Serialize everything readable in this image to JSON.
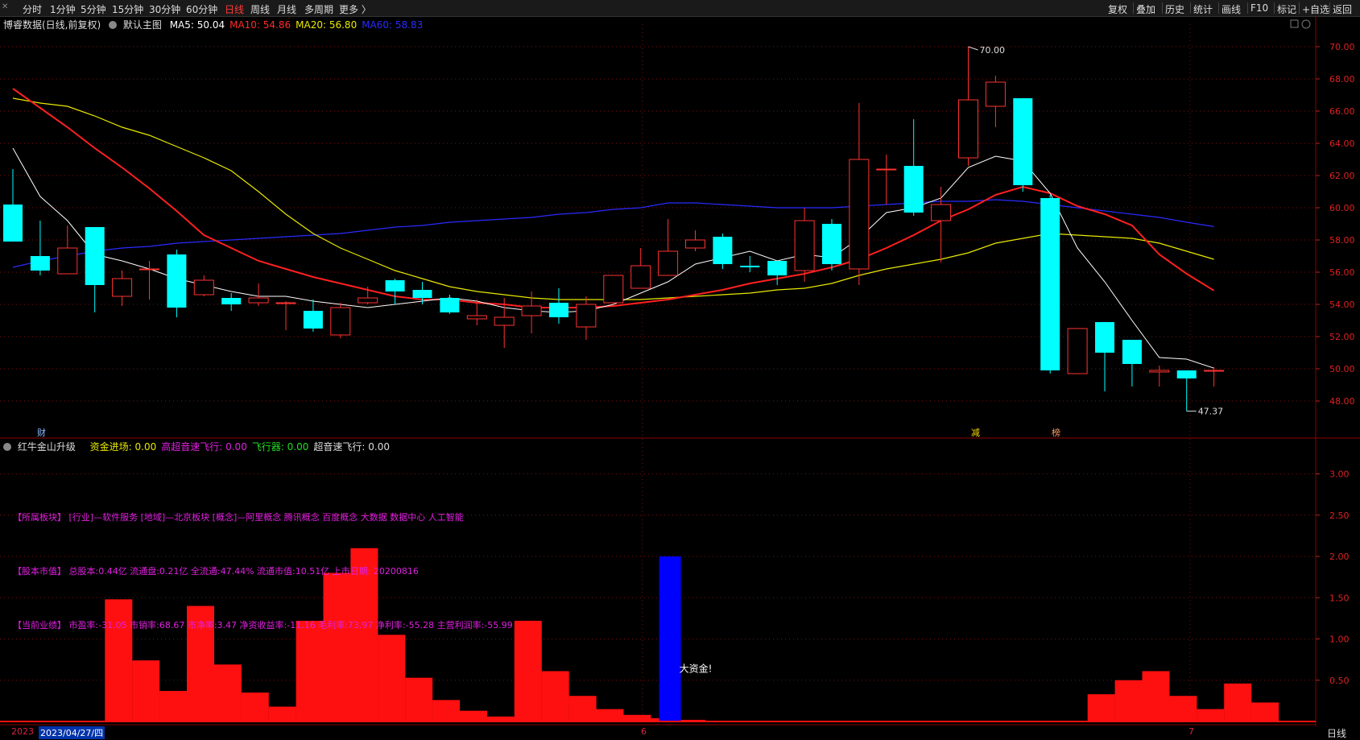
{
  "toolbar": {
    "tabs": [
      {
        "label": "分时"
      },
      {
        "label": "1分钟"
      },
      {
        "label": "5分钟"
      },
      {
        "label": "15分钟"
      },
      {
        "label": "30分钟"
      },
      {
        "label": "60分钟"
      },
      {
        "label": "日线"
      },
      {
        "label": "周线"
      },
      {
        "label": "月线"
      },
      {
        "label": "多周期"
      },
      {
        "label": "更多 〉"
      }
    ],
    "active_tab": "日线",
    "right_buttons": [
      {
        "label": "复权"
      },
      {
        "label": "叠加"
      },
      {
        "label": "历史"
      },
      {
        "label": "统计"
      },
      {
        "label": "画线"
      },
      {
        "label": "F10"
      },
      {
        "label": "标记"
      },
      {
        "label": "+自选"
      },
      {
        "label": "返回"
      }
    ]
  },
  "main_chart": {
    "title": "博睿数据(日线,前复权)",
    "template": "默认主图",
    "ma": [
      {
        "label": "MA5: 50.04",
        "color": "#ffffff"
      },
      {
        "label": "MA10: 54.86",
        "color": "#ff2a2a"
      },
      {
        "label": "MA20: 56.80",
        "color": "#e8e800"
      },
      {
        "label": "MA60: 58.83",
        "color": "#2a2aff"
      }
    ],
    "high_label": "70.00",
    "low_label": "47.37",
    "markers": [
      {
        "text": "财"
      },
      {
        "text": "减"
      },
      {
        "text": "榜"
      }
    ]
  },
  "sub_chart": {
    "title": "红牛金山升级",
    "fields": [
      {
        "label": "资金进场: 0.00",
        "color": "#e8e800"
      },
      {
        "label": "高超音速飞行: 0.00",
        "color": "#e020e0"
      },
      {
        "label": "飞行器: 0.00",
        "color": "#22dd22"
      },
      {
        "label": "超音速飞行: 0.00",
        "color": "#dddddd"
      }
    ],
    "info": [
      "【所属板块】 [行业]—软件服务 [地域]—北京板块 [概念]—阿里概念 腾讯概念 百度概念 大数据 数据中心 人工智能",
      "【股本市值】 总股本:0.44亿 流通盘:0.21亿 全流通:47.44% 流通市值:10.51亿 上市日期: 20200816",
      "【当前业绩】 市盈率:-31.05 市销率:68.67 市净率:3.47 净资收益率:-11.16 毛利率:73.97 净利率:-55.28 主营利润率:-55.99"
    ],
    "big_money_label": "大资金!"
  },
  "axis": {
    "main_ticks": [
      "70.00",
      "68.00",
      "66.00",
      "64.00",
      "62.00",
      "60.00",
      "58.00",
      "56.00",
      "54.00",
      "52.00",
      "50.00",
      "48.00"
    ],
    "sub_ticks": [
      "3.00",
      "2.50",
      "2.00",
      "1.50",
      "1.00",
      "0.50"
    ]
  },
  "bottom": {
    "left_date_prefix": "2023",
    "cursor_date": "2023/04/27/四",
    "month_marks": [
      "6",
      "7"
    ],
    "period": "日线"
  },
  "colors": {
    "up": "#ff3232",
    "down": "#00ffff",
    "ma5": "#ffffff",
    "ma10": "#ff2020",
    "ma20": "#e8e800",
    "ma60": "#2a2aff"
  },
  "chart_data": {
    "type": "candlestick",
    "candles": [
      [
        60.2,
        57.9,
        62.4,
        57.9
      ],
      [
        57.0,
        56.1,
        59.2,
        55.8
      ],
      [
        55.9,
        57.5,
        58.9,
        55.9
      ],
      [
        58.8,
        55.2,
        58.8,
        53.5
      ],
      [
        54.5,
        55.6,
        56.1,
        53.9
      ],
      [
        56.2,
        56.2,
        56.7,
        54.3
      ],
      [
        57.1,
        53.8,
        57.4,
        53.2
      ],
      [
        54.6,
        55.5,
        55.8,
        54.5
      ],
      [
        54.4,
        54.0,
        54.7,
        53.6
      ],
      [
        54.1,
        54.4,
        55.3,
        53.9
      ],
      [
        54.1,
        54.1,
        54.2,
        52.4
      ],
      [
        53.6,
        52.5,
        54.3,
        52.3
      ],
      [
        52.1,
        53.8,
        54.1,
        51.9
      ],
      [
        54.1,
        54.4,
        55.1,
        54.0
      ],
      [
        55.5,
        54.8,
        55.6,
        54.0
      ],
      [
        54.9,
        54.4,
        55.4,
        54.0
      ],
      [
        54.4,
        53.5,
        54.6,
        53.4
      ],
      [
        53.1,
        53.3,
        54.3,
        52.7
      ],
      [
        52.7,
        53.2,
        54.4,
        51.3
      ],
      [
        53.3,
        53.9,
        54.8,
        52.2
      ],
      [
        54.1,
        53.2,
        55.0,
        52.8
      ],
      [
        52.6,
        54.0,
        54.5,
        51.8
      ],
      [
        54.1,
        55.8,
        55.8,
        53.9
      ],
      [
        55.0,
        56.4,
        57.5,
        55.0
      ],
      [
        55.8,
        57.3,
        59.3,
        55.8
      ],
      [
        57.5,
        58.0,
        58.6,
        57.3
      ],
      [
        58.2,
        56.5,
        58.4,
        56.2
      ],
      [
        56.4,
        56.3,
        57.0,
        56.0
      ],
      [
        56.7,
        55.8,
        56.7,
        55.2
      ],
      [
        56.1,
        59.2,
        60.0,
        55.4
      ],
      [
        59.0,
        56.5,
        59.3,
        56.1
      ],
      [
        56.2,
        63.0,
        66.5,
        55.2
      ],
      [
        62.4,
        62.4,
        63.3,
        60.2
      ],
      [
        62.6,
        59.7,
        65.5,
        59.5
      ],
      [
        59.2,
        60.2,
        61.3,
        56.6
      ],
      [
        63.1,
        66.7,
        70.0,
        62.6
      ],
      [
        66.3,
        67.8,
        68.2,
        65.0
      ],
      [
        66.8,
        61.4,
        66.8,
        61.0
      ],
      [
        60.6,
        49.9,
        60.8,
        49.7
      ],
      [
        49.7,
        52.5,
        52.5,
        49.7
      ],
      [
        52.9,
        51.0,
        52.9,
        48.6
      ],
      [
        51.8,
        50.3,
        51.8,
        48.9
      ],
      [
        49.8,
        49.9,
        50.2,
        48.9
      ],
      [
        49.9,
        49.4,
        49.9,
        47.37
      ],
      [
        49.9,
        49.9,
        50.1,
        48.9
      ]
    ],
    "ma5": [
      63.7,
      60.7,
      59.2,
      57.1,
      56.7,
      56.2,
      55.6,
      55.2,
      54.8,
      54.5,
      54.5,
      54.2,
      54.0,
      53.8,
      54.0,
      54.2,
      54.4,
      54.2,
      53.8,
      53.6,
      53.5,
      53.6,
      54.0,
      54.7,
      55.4,
      56.5,
      56.9,
      57.3,
      56.7,
      57.1,
      56.9,
      58.1,
      59.7,
      60.0,
      60.6,
      62.5,
      63.2,
      62.9,
      60.9,
      57.5,
      55.4,
      53.0,
      50.7,
      50.6,
      50.04
    ],
    "ma10": [
      67.4,
      66.2,
      65.0,
      63.7,
      62.5,
      61.2,
      59.8,
      58.3,
      57.5,
      56.7,
      56.2,
      55.7,
      55.3,
      54.9,
      54.5,
      54.3,
      54.3,
      54.1,
      54.0,
      53.8,
      53.8,
      53.8,
      53.9,
      54.1,
      54.3,
      54.6,
      54.9,
      55.3,
      55.6,
      55.9,
      56.3,
      56.8,
      57.5,
      58.3,
      59.2,
      59.9,
      60.8,
      61.3,
      60.9,
      60.1,
      59.6,
      58.9,
      57.1,
      55.9,
      54.86
    ],
    "ma20": [
      66.8,
      66.5,
      66.3,
      65.7,
      65.0,
      64.5,
      63.8,
      63.1,
      62.3,
      61.0,
      59.6,
      58.4,
      57.5,
      56.8,
      56.1,
      55.6,
      55.1,
      54.8,
      54.6,
      54.4,
      54.3,
      54.3,
      54.3,
      54.3,
      54.4,
      54.5,
      54.6,
      54.7,
      54.9,
      55.0,
      55.3,
      55.8,
      56.2,
      56.5,
      56.8,
      57.2,
      57.8,
      58.1,
      58.4,
      58.3,
      58.2,
      58.1,
      57.8,
      57.3,
      56.8
    ],
    "ma60": [
      56.3,
      56.7,
      57.0,
      57.3,
      57.5,
      57.6,
      57.8,
      57.9,
      58.0,
      58.1,
      58.2,
      58.3,
      58.4,
      58.6,
      58.8,
      58.9,
      59.1,
      59.2,
      59.3,
      59.4,
      59.6,
      59.7,
      59.9,
      60.0,
      60.3,
      60.3,
      60.2,
      60.1,
      60.0,
      60.0,
      60.0,
      60.1,
      60.2,
      60.3,
      60.4,
      60.4,
      60.5,
      60.4,
      60.2,
      60.0,
      59.8,
      59.6,
      59.4,
      59.1,
      58.83
    ],
    "sub_bars": [
      0,
      0,
      1.48,
      0.74,
      0.37,
      1.4,
      0.69,
      0.35,
      0.18,
      1.22,
      1.8,
      2.1,
      1.05,
      0.53,
      0.26,
      0.13,
      0.06,
      1.22,
      0.61,
      0.31,
      0.15,
      0.08,
      0.04,
      0.02,
      0,
      0,
      0,
      0,
      0,
      0,
      0,
      0,
      0,
      0,
      0,
      0,
      0,
      0,
      0.33,
      0.5,
      0.61,
      0.31,
      0.15,
      0.46,
      0.23
    ],
    "big_money_index": 24,
    "big_money_value": 2.0,
    "main_ylim": [
      46.0,
      71.0
    ],
    "sub_ylim": [
      0,
      3.2
    ]
  }
}
